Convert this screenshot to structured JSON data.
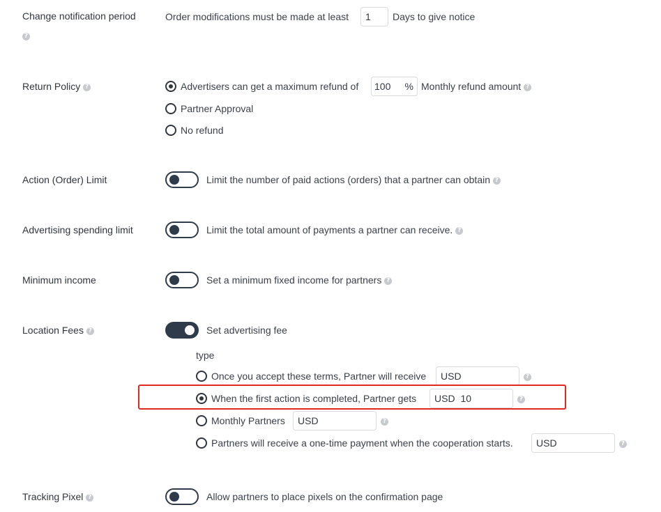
{
  "change_notification": {
    "label": "Change notification period",
    "prefix": "Order modifications must be made at least",
    "days_value": "1",
    "suffix": "Days to give notice"
  },
  "return_policy": {
    "label": "Return Policy",
    "options": [
      {
        "label_before": "Advertisers can get a maximum refund of",
        "value": "100",
        "unit": "%",
        "label_after": "Monthly refund amount",
        "selected": true
      },
      {
        "label": "Partner Approval",
        "selected": false
      },
      {
        "label": "No refund",
        "selected": false
      }
    ]
  },
  "action_limit": {
    "label": "Action (Order) Limit",
    "description": "Limit the number of paid actions (orders) that a partner can obtain",
    "enabled": false
  },
  "spending_limit": {
    "label": "Advertising spending limit",
    "description": "Limit the total amount of payments a partner can receive.",
    "enabled": false
  },
  "minimum_income": {
    "label": "Minimum income",
    "description": "Set a minimum fixed income for partners",
    "enabled": false
  },
  "location_fees": {
    "label": "Location Fees",
    "description": "Set advertising fee",
    "enabled": true,
    "type_label": "type",
    "options": [
      {
        "label": "Once you accept these terms, Partner will receive",
        "currency": "USD",
        "amount": "",
        "selected": false
      },
      {
        "label": "When the first action is completed, Partner gets",
        "currency": "USD",
        "amount": "10",
        "selected": true
      },
      {
        "label": "Monthly Partners",
        "currency": "USD",
        "amount": "",
        "selected": false
      },
      {
        "label": "Partners will receive a one-time payment when the cooperation starts.",
        "currency": "USD",
        "amount": "",
        "selected": false
      }
    ]
  },
  "tracking_pixel": {
    "label": "Tracking Pixel",
    "description": "Allow partners to place pixels on the confirmation page",
    "enabled": false
  },
  "help_glyph": "?",
  "colors": {
    "text": "#2f3640",
    "toggle_dark": "#2f3b4a",
    "highlight": "#e0281e",
    "help_icon": "#c6cacf"
  }
}
